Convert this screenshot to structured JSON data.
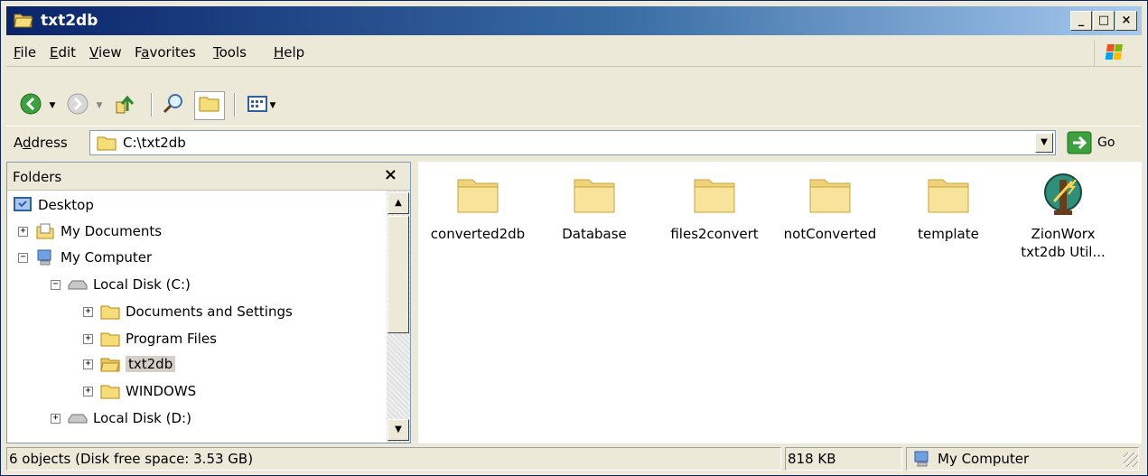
{
  "window": {
    "title": "txt2db",
    "minimize": "_",
    "maximize": "□",
    "close": "×"
  },
  "menu": [
    {
      "label": "File",
      "accel": "F",
      "rest": "ile"
    },
    {
      "label": "Edit",
      "accel": "E",
      "rest": "dit"
    },
    {
      "label": "View",
      "accel": "V",
      "rest": "iew"
    },
    {
      "label": "Favorites",
      "accel": "a",
      "pre": "F",
      "rest": "vorites"
    },
    {
      "label": "Tools",
      "accel": "T",
      "rest": "ools"
    },
    {
      "label": "Help",
      "accel": "H",
      "rest": "elp"
    }
  ],
  "toolbar": {
    "back": "back-icon",
    "forward": "forward-icon",
    "up": "up-icon",
    "search": "search-icon",
    "folders": "folders-icon",
    "views": "views-icon"
  },
  "address": {
    "label_pre": "A",
    "label_accel": "d",
    "label_post": "dress",
    "value": "C:\\txt2db",
    "go": "Go"
  },
  "folders": {
    "title": "Folders",
    "close": "×",
    "tree": [
      {
        "label": "Desktop",
        "level": 0,
        "icon": "desktop-icon",
        "exp": ""
      },
      {
        "label": "My Documents",
        "level": 1,
        "icon": "my-documents-icon",
        "exp": "+"
      },
      {
        "label": "My Computer",
        "level": 1,
        "icon": "my-computer-icon",
        "exp": "−"
      },
      {
        "label": "Local Disk (C:)",
        "level": 2,
        "icon": "drive-icon",
        "exp": "−"
      },
      {
        "label": "Documents and Settings",
        "level": 3,
        "icon": "folder-icon",
        "exp": "+"
      },
      {
        "label": "Program Files",
        "level": 3,
        "icon": "folder-icon",
        "exp": "+"
      },
      {
        "label": "txt2db",
        "level": 3,
        "icon": "folder-open-icon",
        "exp": "+",
        "selected": true
      },
      {
        "label": "WINDOWS",
        "level": 3,
        "icon": "folder-icon",
        "exp": "+"
      },
      {
        "label": "Local Disk (D:)",
        "level": 2,
        "icon": "drive-icon",
        "exp": "+"
      }
    ]
  },
  "files": [
    {
      "label": "converted2db",
      "icon": "folder-icon"
    },
    {
      "label": "Database",
      "icon": "folder-icon"
    },
    {
      "label": "files2convert",
      "icon": "folder-icon"
    },
    {
      "label": "notConverted",
      "icon": "folder-icon"
    },
    {
      "label": "template",
      "icon": "folder-icon"
    },
    {
      "label": "ZionWorx\ntxt2db Util...",
      "line1": "ZionWorx",
      "line2": "txt2db Util...",
      "icon": "zionworx-app-icon"
    }
  ],
  "status": {
    "objects": "6 objects (Disk free space: 3.53 GB)",
    "size": "818 KB",
    "location": "My Computer"
  },
  "colors": {
    "titlebar": "#0a246a",
    "folder": "#f5dd7a",
    "chrome": "#ece9d8"
  }
}
